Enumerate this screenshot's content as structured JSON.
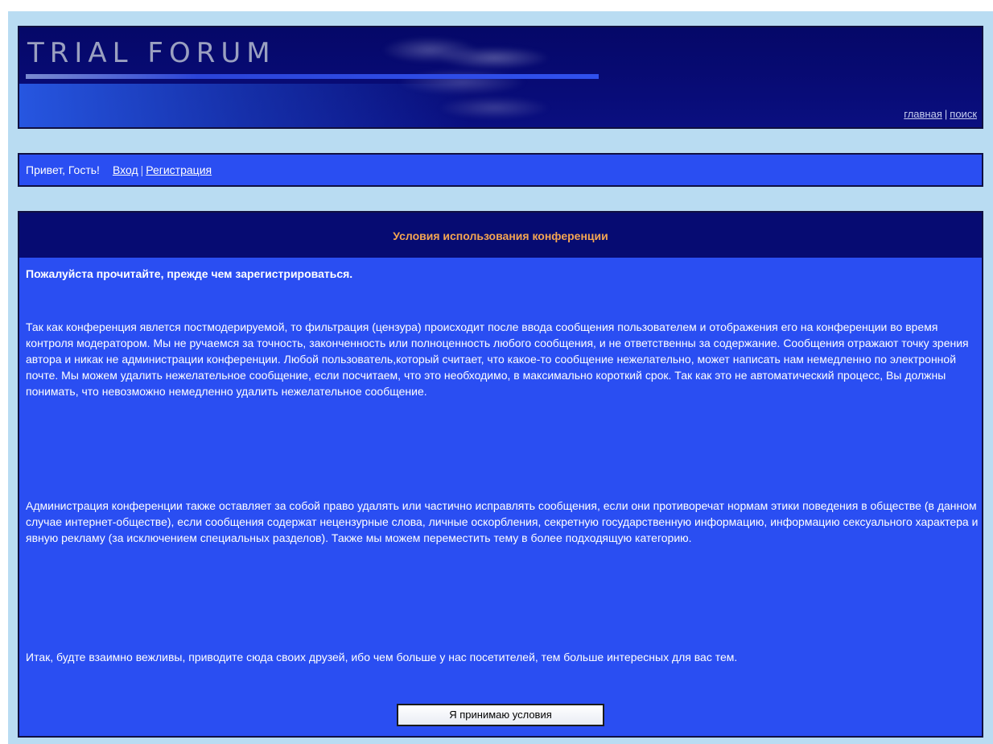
{
  "header": {
    "logo_text": "TRIAL FORUM",
    "links": {
      "home": "главная",
      "separator": "|",
      "search": "поиск"
    }
  },
  "greeting": {
    "text": "Привет, Гость!",
    "login": "Вход",
    "separator": "|",
    "register": "Регистрация"
  },
  "terms": {
    "title": "Условия использования конференции",
    "subtitle": "Пожалуйста прочитайте, прежде чем зарегистрироваться.",
    "paragraph_1": "Так как конференция явлется постмодерируемой, то фильтрация (цензура) происходит после ввода сообщения пользователем и отображения его на конференции во время контроля модератором. Мы не ручаемся за точность, законченность или полноценность любого сообщения, и не ответственны за содержание. Сообщения отражают точку зрения автора и никак не администрации конференции. Любой пользователь,который считает, что какое-то сообщение нежелательно, может написать нам немедленно по электронной почте. Мы можем удалить нежелательное сообщение, если посчитаем, что это необходимо, в максимально короткий срок. Так как это не автоматический процесс, Вы должны понимать, что невозможно немедленно удалить нежелательное сообщение.",
    "paragraph_2": "Администрация конференции также оставляет за собой право удалять или частично исправлять сообщения, если они противоречат нормам этики поведения в обществе (в данном случае интернет-обществе), если сообщения содержат нецензурные слова, личные оскорбления, секретную государственную информацию, информацию сексуального характера и явную рекламу (за исключением специальных разделов). Также мы можем переместить тему в более подходящую категорию.",
    "paragraph_3": "Итак, будте взаимно вежливы, приводите сюда своих друзей, ибо чем больше у нас посетителей, тем больше интересных для вас тем.",
    "accept_button": "Я принимаю условия"
  },
  "colors": {
    "page_background": "#b9dcf2",
    "header_background": "#060b72",
    "panel_background": "#2a4ef2",
    "title_color": "#f3a552"
  }
}
